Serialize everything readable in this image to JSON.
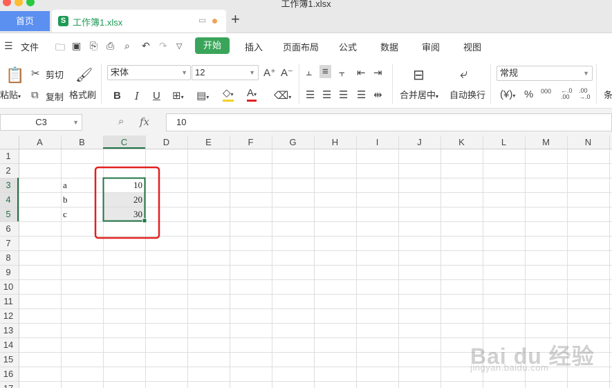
{
  "window": {
    "title": "工作簿1.xlsx"
  },
  "tabs": {
    "home": "首页",
    "file": "工作簿1.xlsx",
    "new_tab": "+"
  },
  "menu": {
    "file": "文件",
    "start": "开始",
    "insert": "插入",
    "page_layout": "页面布局",
    "formula": "公式",
    "data": "数据",
    "review": "审阅",
    "view": "视图"
  },
  "ribbon": {
    "paste": "粘贴",
    "cut": "剪切",
    "copy": "复制",
    "format_painter": "格式刷",
    "font_name": "宋体",
    "font_size": "12",
    "merge_center": "合并居中",
    "auto_wrap": "自动换行",
    "number_format": "常规",
    "cond_format": "条",
    "bold": "B",
    "italic": "I",
    "underline": "U",
    "font_grow": "A⁺",
    "font_shrink": "A⁻",
    "percent": "%",
    "thousands": "000",
    "inc_decimal": "←.0 .00",
    "dec_decimal": ".00 →.0",
    "currency": "¥"
  },
  "formula_bar": {
    "cell_ref": "C3",
    "fx": "fx",
    "value": "10"
  },
  "sheet": {
    "columns": [
      "A",
      "B",
      "C",
      "D",
      "E",
      "F",
      "G",
      "H",
      "I",
      "J",
      "K",
      "L",
      "M",
      "N"
    ],
    "rows": [
      "1",
      "2",
      "3",
      "4",
      "5",
      "6",
      "7",
      "8",
      "9",
      "10",
      "11",
      "12",
      "13",
      "14",
      "15",
      "16",
      "17"
    ],
    "cells": {
      "B3": "a",
      "B4": "b",
      "B5": "c",
      "C3": "10",
      "C4": "20",
      "C5": "30"
    },
    "selected_range": "C3:C5",
    "highlight_color": "#e02020",
    "selection_color": "#217346"
  },
  "watermark": {
    "brand": "Bai du 经验",
    "url": "jingyan.baidu.com"
  }
}
